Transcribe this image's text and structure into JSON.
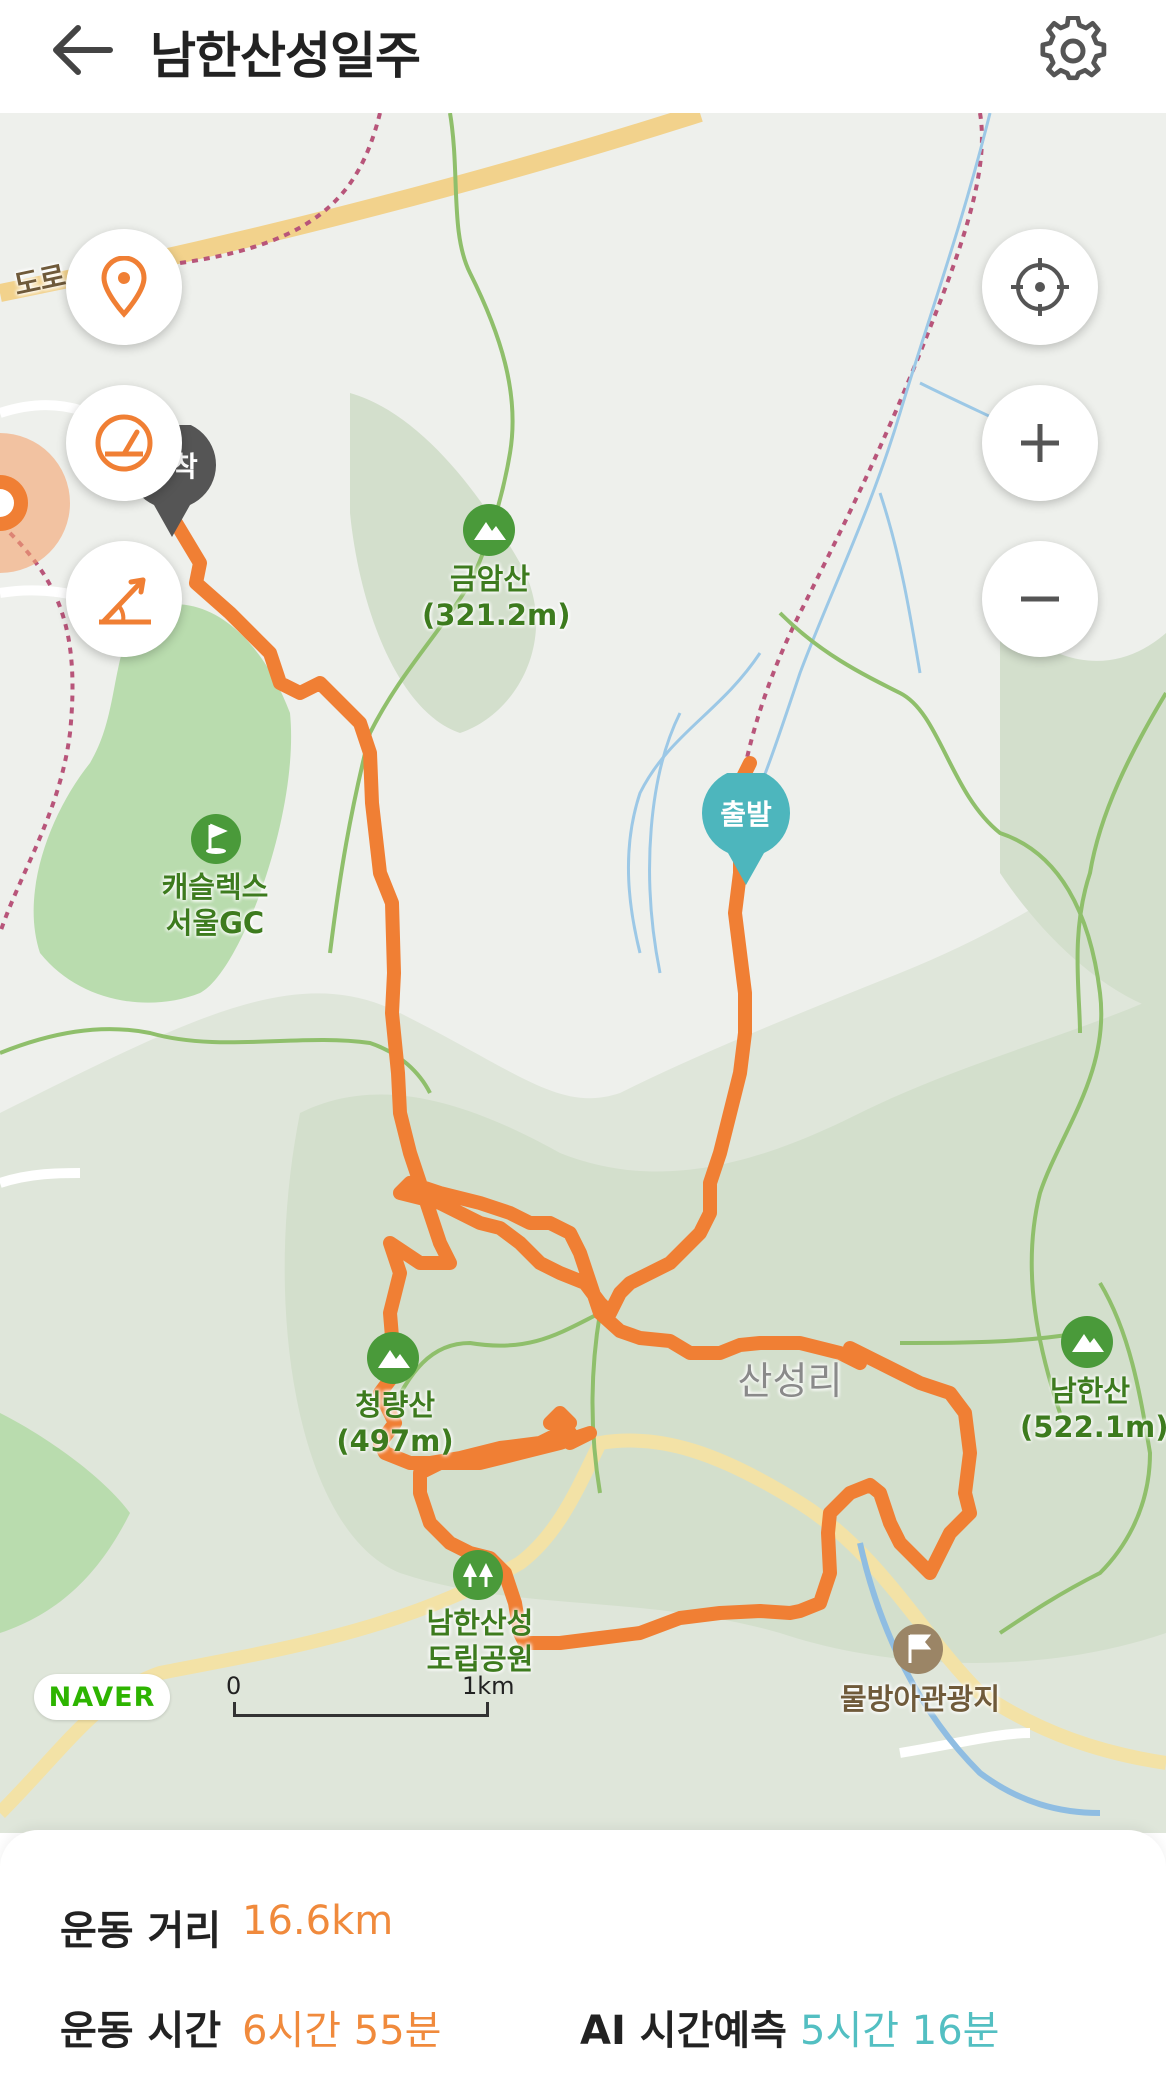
{
  "header": {
    "title": "남한산성일주",
    "back_icon": "arrow-left-icon",
    "settings_icon": "gear-icon"
  },
  "map": {
    "road_label": "도로",
    "pins": {
      "start": "출발",
      "end": "도착"
    },
    "places": {
      "geumamsan": {
        "name": "금암산",
        "elev": "(321.2m)"
      },
      "golf": {
        "line1": "캐슬렉스",
        "line2": "서울GC"
      },
      "cheongryangsan": {
        "name": "청량산",
        "elev": "(497m)"
      },
      "sanseongri": "산성리",
      "namhansan": {
        "name": "남한산",
        "elev": "(522.1m)"
      },
      "park": {
        "line1": "남한산성",
        "line2": "도립공원"
      },
      "mulbang": "물방아관광지"
    },
    "logo": "NAVER",
    "scale": {
      "start": "0",
      "end": "1km"
    },
    "left_buttons": [
      "location-pin-icon",
      "speedometer-icon",
      "elevation-icon"
    ],
    "right_buttons": [
      "crosshair-icon",
      "zoom-in-icon",
      "zoom-out-icon"
    ],
    "colors": {
      "route": "#f07f34",
      "start_pin": "#4db6bd",
      "end_pin": "#555555",
      "mountain": "#4a9a3a"
    }
  },
  "stats": {
    "distance_label": "운동 거리",
    "distance_value": "16.6km",
    "time_label": "운동 시간",
    "time_value": "6시간 55분",
    "ai_label": "AI 시간예측",
    "ai_value": "5시간 16분"
  }
}
